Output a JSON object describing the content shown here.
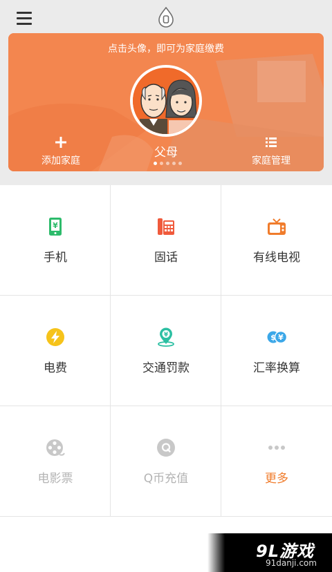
{
  "header": {
    "menu_icon": "hamburger-menu-icon",
    "logo_icon": "app-logo-icon"
  },
  "banner": {
    "hint": "点击头像，即可为家庭缴费",
    "family_name": "父母",
    "add_family_label": "添加家庭",
    "manage_family_label": "家庭管理",
    "page_count": 5,
    "active_page": 0
  },
  "services": [
    {
      "label": "手机",
      "icon": "mobile-phone-icon",
      "color": "#2dbb6b"
    },
    {
      "label": "固话",
      "icon": "landline-phone-icon",
      "color": "#f05a3c"
    },
    {
      "label": "有线电视",
      "icon": "tv-icon",
      "color": "#f07c2c"
    },
    {
      "label": "电费",
      "icon": "lightning-icon",
      "color": "#f6c31a"
    },
    {
      "label": "交通罚款",
      "icon": "traffic-fine-location-icon",
      "color": "#2bbfa2"
    },
    {
      "label": "汇率换算",
      "icon": "currency-exchange-icon",
      "color": "#3ba7e8"
    },
    {
      "label": "电影票",
      "icon": "film-reel-icon",
      "color": "#c8c8c8"
    },
    {
      "label": "Q币充值",
      "icon": "q-coin-icon",
      "color": "#c8c8c8"
    },
    {
      "label": "更多",
      "icon": "more-dots-icon",
      "color": "#c8c8c8"
    }
  ],
  "watermark": {
    "brand": "9L游戏",
    "url": "91danji.com"
  },
  "colors": {
    "accent": "#f07c2c",
    "banner": "#f5844e",
    "disabled": "#b4b4b4"
  }
}
